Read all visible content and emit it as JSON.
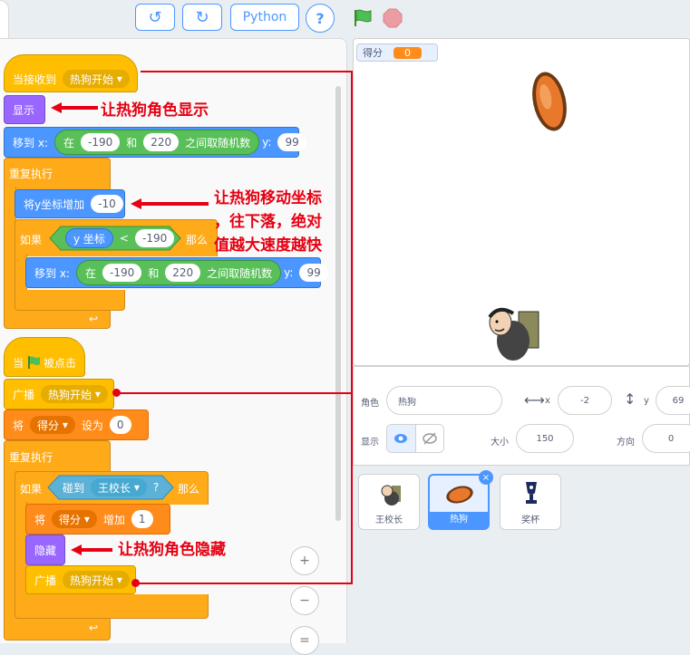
{
  "toolbar": {
    "undo_icon": "↺",
    "redo_icon": "↻",
    "python_label": "Python",
    "help_label": "?"
  },
  "script1": {
    "hat_label": "当接收到",
    "hat_message": "热狗开始",
    "show_label": "显示",
    "goto_label": "移到 x:",
    "random_label": "在",
    "random_min": "-190",
    "random_and": "和",
    "random_max": "220",
    "random_suffix": "之间取随机数",
    "y_label": "y:",
    "y_value": "99",
    "forever_label": "重复执行",
    "change_y_label": "将y坐标增加",
    "change_y_value": "-10",
    "if_label": "如果",
    "ycoord_label": "y 坐标",
    "lt_symbol": "<",
    "compare_value": "-190",
    "then_label": "那么",
    "goto2_label": "移到 x:",
    "random2_label": "在",
    "random2_min": "-190",
    "random2_and": "和",
    "random2_max": "220",
    "random2_suffix": "之间取随机数",
    "y2_label": "y:",
    "y2_value": "99"
  },
  "script2": {
    "hat_label": "当",
    "hat_suffix": "被点击",
    "broadcast_label": "广播",
    "broadcast_message": "热狗开始",
    "set_label": "将",
    "set_var": "得分",
    "set_to": "设为",
    "set_value": "0",
    "forever_label": "重复执行",
    "if_label": "如果",
    "touch_label": "碰到",
    "touch_target": "王校长",
    "touch_q": "?",
    "then_label": "那么",
    "change_label": "将",
    "change_var": "得分",
    "change_by": "增加",
    "change_value": "1",
    "hide_label": "隐藏",
    "broadcast2_label": "广播",
    "broadcast2_message": "热狗开始"
  },
  "annotations": {
    "show_note": "让热狗角色显示",
    "move_note_1": "让热狗移动坐标",
    "move_note_2": "，往下落，绝对",
    "move_note_3": "值越大速度越快",
    "hide_note": "让热狗角色隐藏"
  },
  "zoom": {
    "zoom_in": "+",
    "zoom_out": "−",
    "reset": "="
  },
  "stage": {
    "score_label": "得分",
    "score_value": "0"
  },
  "sprite_info": {
    "sprite_label": "角色",
    "sprite_name": "热狗",
    "x_label": "x",
    "x_value": "-2",
    "y_label": "y",
    "y_value": "69",
    "show_label": "显示",
    "size_label": "大小",
    "size_value": "150",
    "direction_label": "方向",
    "direction_value": "0"
  },
  "sprites": [
    {
      "name": "王校长"
    },
    {
      "name": "热狗"
    },
    {
      "name": "奖杯"
    }
  ],
  "colors": {
    "events": "#ffbf00",
    "looks": "#9966ff",
    "motion": "#4c97ff",
    "control": "#ffab19",
    "variables": "#ff8c1a",
    "operators": "#59c059",
    "sensing": "#5cb1d6",
    "annotation": "#e60012",
    "selected": "#4c97ff"
  }
}
